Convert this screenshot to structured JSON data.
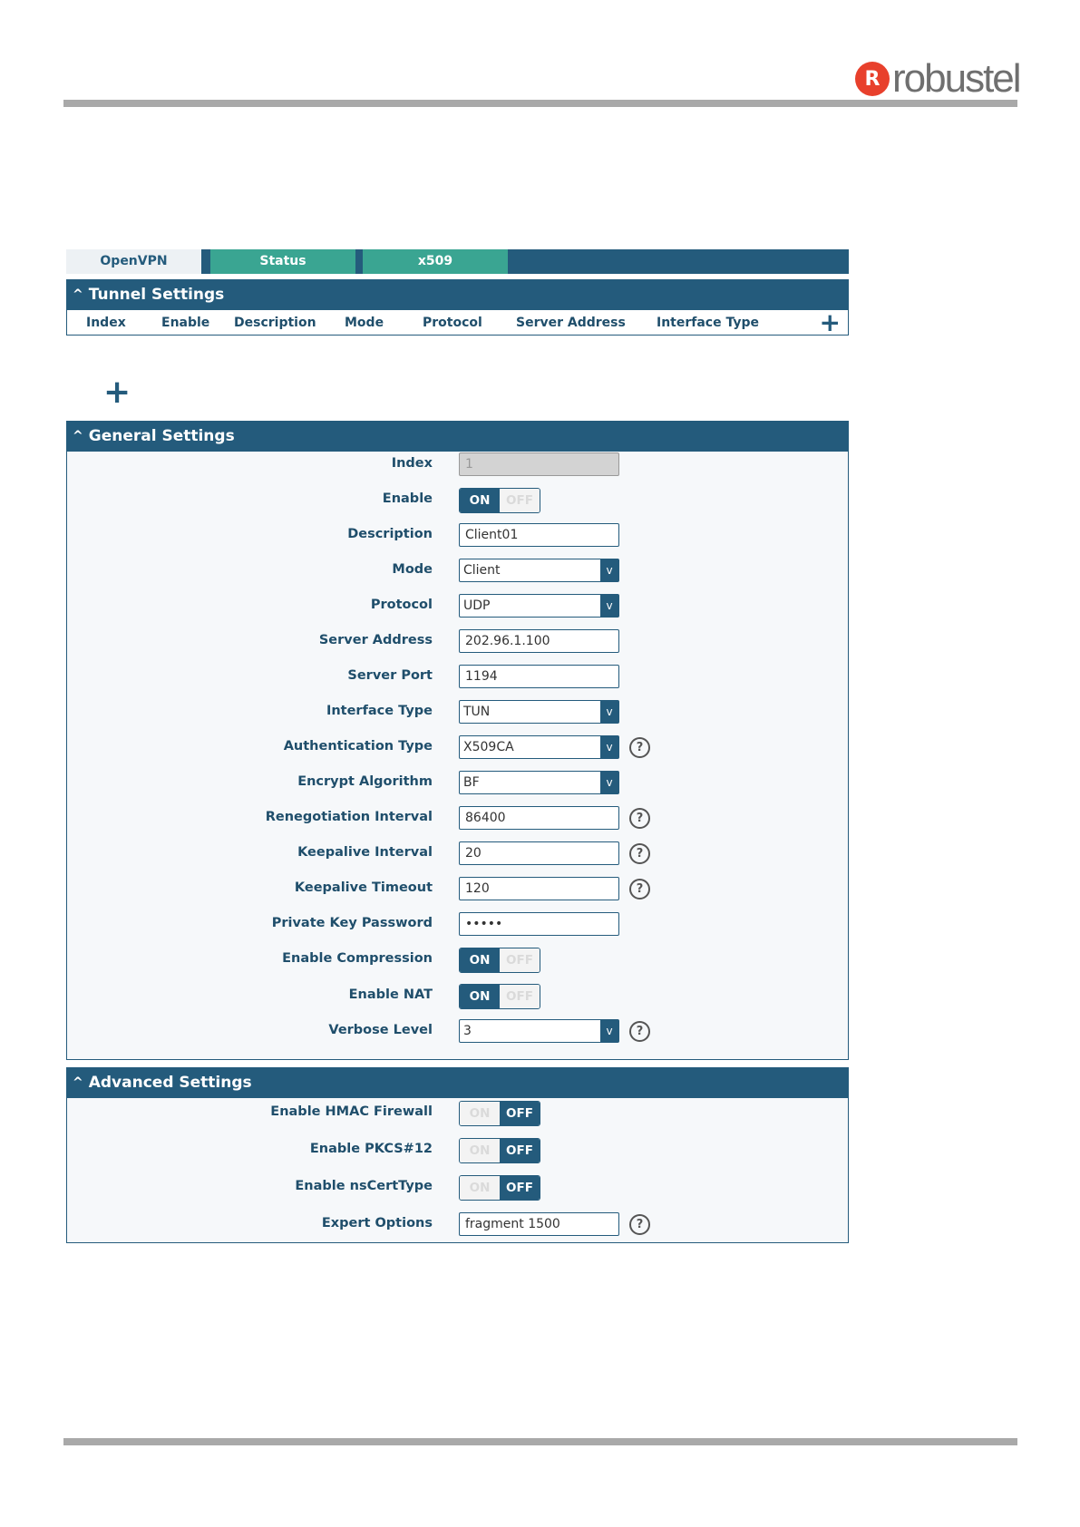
{
  "brand": {
    "mark": "R",
    "name": "robustel"
  },
  "tabs": [
    {
      "label": "OpenVPN"
    },
    {
      "label": "Status"
    },
    {
      "label": "x509"
    }
  ],
  "tunnel": {
    "title": "Tunnel Settings",
    "columns": [
      "Index",
      "Enable",
      "Description",
      "Mode",
      "Protocol",
      "Server Address",
      "Interface Type"
    ],
    "add_icon": "+"
  },
  "add_icon": "+",
  "general": {
    "title": "General Settings",
    "index": {
      "label": "Index",
      "value": "1"
    },
    "enable": {
      "label": "Enable",
      "on": "ON",
      "off": "OFF"
    },
    "description": {
      "label": "Description",
      "value": "Client01"
    },
    "mode": {
      "label": "Mode",
      "value": "Client"
    },
    "protocol": {
      "label": "Protocol",
      "value": "UDP"
    },
    "server_address": {
      "label": "Server Address",
      "value": "202.96.1.100"
    },
    "server_port": {
      "label": "Server Port",
      "value": "1194"
    },
    "interface_type": {
      "label": "Interface Type",
      "value": "TUN"
    },
    "auth_type": {
      "label": "Authentication Type",
      "value": "X509CA"
    },
    "encrypt": {
      "label": "Encrypt Algorithm",
      "value": "BF"
    },
    "renegotiation": {
      "label": "Renegotiation Interval",
      "value": "86400"
    },
    "keepalive_interval": {
      "label": "Keepalive Interval",
      "value": "20"
    },
    "keepalive_timeout": {
      "label": "Keepalive Timeout",
      "value": "120"
    },
    "private_key_password": {
      "label": "Private Key Password",
      "value": "•••••"
    },
    "enable_compression": {
      "label": "Enable Compression",
      "on": "ON",
      "off": "OFF"
    },
    "enable_nat": {
      "label": "Enable NAT",
      "on": "ON",
      "off": "OFF"
    },
    "verbose_level": {
      "label": "Verbose Level",
      "value": "3"
    }
  },
  "advanced": {
    "title": "Advanced Settings",
    "hmac": {
      "label": "Enable HMAC Firewall",
      "on": "ON",
      "off": "OFF"
    },
    "pkcs12": {
      "label": "Enable PKCS#12",
      "on": "ON",
      "off": "OFF"
    },
    "nscerttype": {
      "label": "Enable nsCertType",
      "on": "ON",
      "off": "OFF"
    },
    "expert": {
      "label": "Expert Options",
      "value": "fragment 1500"
    }
  },
  "icons": {
    "help": "?",
    "dropdown": "v",
    "chevron": "^"
  }
}
